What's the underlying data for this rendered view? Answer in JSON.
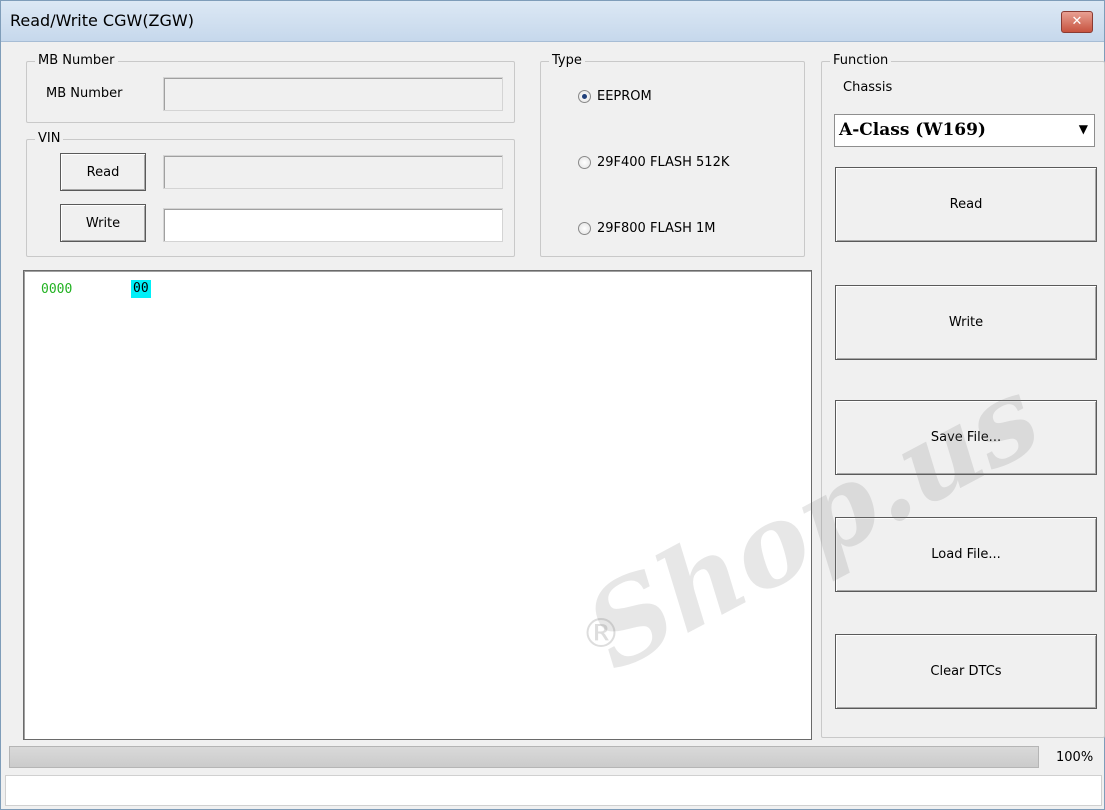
{
  "window": {
    "title": "Read/Write CGW(ZGW)",
    "close_glyph": "✕"
  },
  "mb_group": {
    "legend": "MB Number",
    "label": "MB Number",
    "value": ""
  },
  "vin_group": {
    "legend": "VIN",
    "read_label": "Read",
    "write_label": "Write",
    "read_value": "",
    "write_value": ""
  },
  "type_group": {
    "legend": "Type",
    "options": [
      {
        "label": "EEPROM",
        "checked": true
      },
      {
        "label": "29F400 FLASH 512K",
        "checked": false
      },
      {
        "label": "29F800 FLASH 1M",
        "checked": false
      }
    ]
  },
  "function_group": {
    "legend": "Function",
    "chassis_label": "Chassis",
    "chassis_value": "A-Class (W169)",
    "buttons": {
      "read": "Read",
      "write": "Write",
      "save": "Save File...",
      "load": "Load File...",
      "clear": "Clear DTCs"
    }
  },
  "hex": {
    "address": "0000",
    "byte": "00"
  },
  "progress": {
    "value": 1.0,
    "label": "100%"
  },
  "watermark": {
    "text": "Shop.us",
    "registered": "®"
  },
  "icons": {
    "dropdown": "chevron-down-icon"
  }
}
